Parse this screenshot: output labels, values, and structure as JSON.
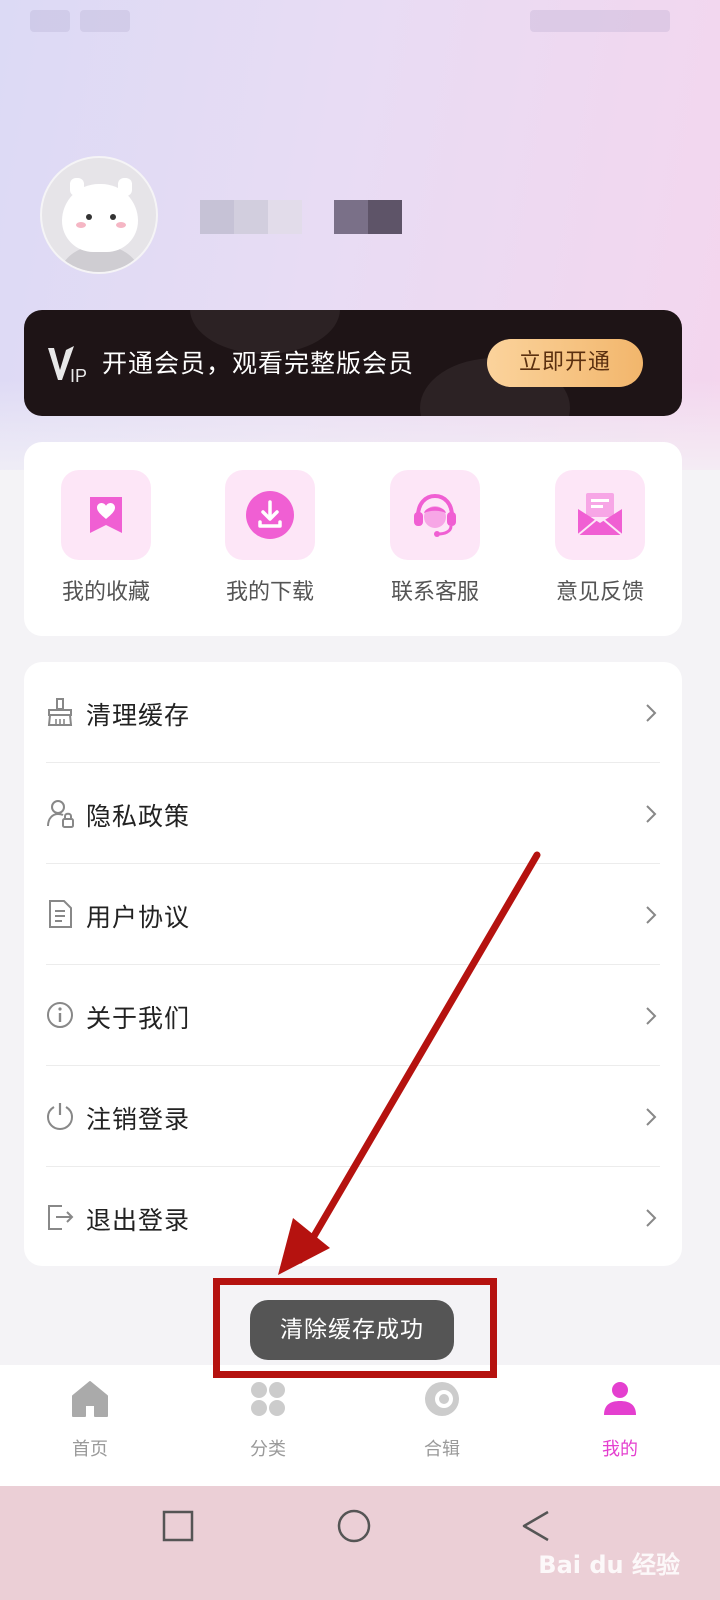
{
  "profile": {
    "avatar_alt": "avatar"
  },
  "vip_banner": {
    "logo_text": "VIP",
    "text": "开通会员，观看完整版会员",
    "button_label": "立即开通"
  },
  "quick_actions": [
    {
      "label": "我的收藏",
      "icon": "bookmark-heart-icon"
    },
    {
      "label": "我的下载",
      "icon": "download-icon"
    },
    {
      "label": "联系客服",
      "icon": "customer-service-icon"
    },
    {
      "label": "意见反馈",
      "icon": "feedback-mail-icon"
    }
  ],
  "menu": [
    {
      "label": "清理缓存",
      "icon": "broom-icon"
    },
    {
      "label": "隐私政策",
      "icon": "user-lock-icon"
    },
    {
      "label": "用户协议",
      "icon": "document-icon"
    },
    {
      "label": "关于我们",
      "icon": "info-icon"
    },
    {
      "label": "注销登录",
      "icon": "power-icon"
    },
    {
      "label": "退出登录",
      "icon": "logout-icon"
    }
  ],
  "toast": {
    "text": "清除缓存成功"
  },
  "tabbar": [
    {
      "label": "首页",
      "icon": "home-icon",
      "active": false
    },
    {
      "label": "分类",
      "icon": "category-icon",
      "active": false
    },
    {
      "label": "合辑",
      "icon": "collection-icon",
      "active": false
    },
    {
      "label": "我的",
      "icon": "profile-icon",
      "active": true
    }
  ],
  "watermark": {
    "text": "Bai du 经验"
  },
  "colors": {
    "accent": "#e43fcf",
    "vip_bg": "#1e1416",
    "vip_button": "#f2b66c",
    "highlight": "#b5120f",
    "toast_bg": "#555555"
  }
}
